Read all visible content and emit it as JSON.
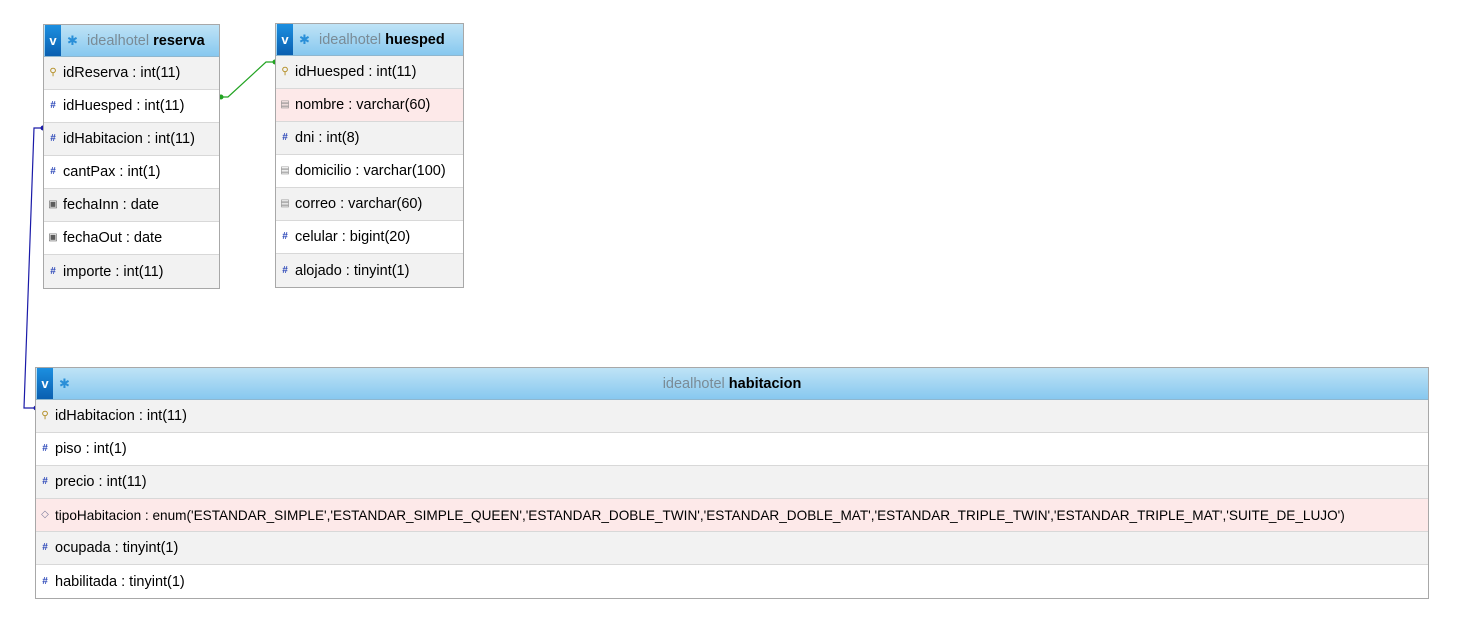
{
  "tables": {
    "reserva": {
      "db": "idealhotel",
      "name": "reserva",
      "collapse_label": "v",
      "fields": [
        {
          "label": "idReserva : int(11)",
          "icon": "key-icon"
        },
        {
          "label": "idHuesped : int(11)",
          "icon": "hash-icon"
        },
        {
          "label": "idHabitacion : int(11)",
          "icon": "hash-icon"
        },
        {
          "label": "cantPax : int(1)",
          "icon": "hash-icon"
        },
        {
          "label": "fechaInn : date",
          "icon": "date-icon"
        },
        {
          "label": "fechaOut : date",
          "icon": "date-icon"
        },
        {
          "label": "importe : int(11)",
          "icon": "hash-icon"
        }
      ]
    },
    "huesped": {
      "db": "idealhotel",
      "name": "huesped",
      "collapse_label": "v",
      "fields": [
        {
          "label": "idHuesped : int(11)",
          "icon": "key-icon"
        },
        {
          "label": "nombre : varchar(60)",
          "icon": "text-icon"
        },
        {
          "label": "dni : int(8)",
          "icon": "hash-icon"
        },
        {
          "label": "domicilio : varchar(100)",
          "icon": "text-icon"
        },
        {
          "label": "correo : varchar(60)",
          "icon": "text-icon"
        },
        {
          "label": "celular : bigint(20)",
          "icon": "hash-icon"
        },
        {
          "label": "alojado : tinyint(1)",
          "icon": "hash-icon"
        }
      ]
    },
    "habitacion": {
      "db": "idealhotel",
      "name": "habitacion",
      "collapse_label": "v",
      "fields": [
        {
          "label": "idHabitacion : int(11)",
          "icon": "key-icon"
        },
        {
          "label": "piso : int(1)",
          "icon": "hash-icon"
        },
        {
          "label": "precio : int(11)",
          "icon": "hash-icon"
        },
        {
          "label": "tipoHabitacion : enum('ESTANDAR_SIMPLE','ESTANDAR_SIMPLE_QUEEN','ESTANDAR_DOBLE_TWIN','ESTANDAR_DOBLE_MAT','ESTANDAR_TRIPLE_TWIN','ESTANDAR_TRIPLE_MAT','SUITE_DE_LUJO')",
          "icon": "enum-icon"
        },
        {
          "label": "ocupada : tinyint(1)",
          "icon": "hash-icon"
        },
        {
          "label": "habilitada : tinyint(1)",
          "icon": "hash-icon"
        }
      ]
    }
  },
  "relations": [
    {
      "from": "reserva.idHuesped",
      "to": "huesped.idHuesped",
      "color": "#22a322"
    },
    {
      "from": "reserva.idHabitacion",
      "to": "habitacion.idHabitacion",
      "color": "#1a1aa8"
    }
  ],
  "colors": {
    "header_top": "#bfe3f6",
    "header_bottom": "#87c8ef",
    "row_alt": "#f2f2f2",
    "row_highlight": "#fde9e9",
    "db_name": "#7a8b96"
  }
}
